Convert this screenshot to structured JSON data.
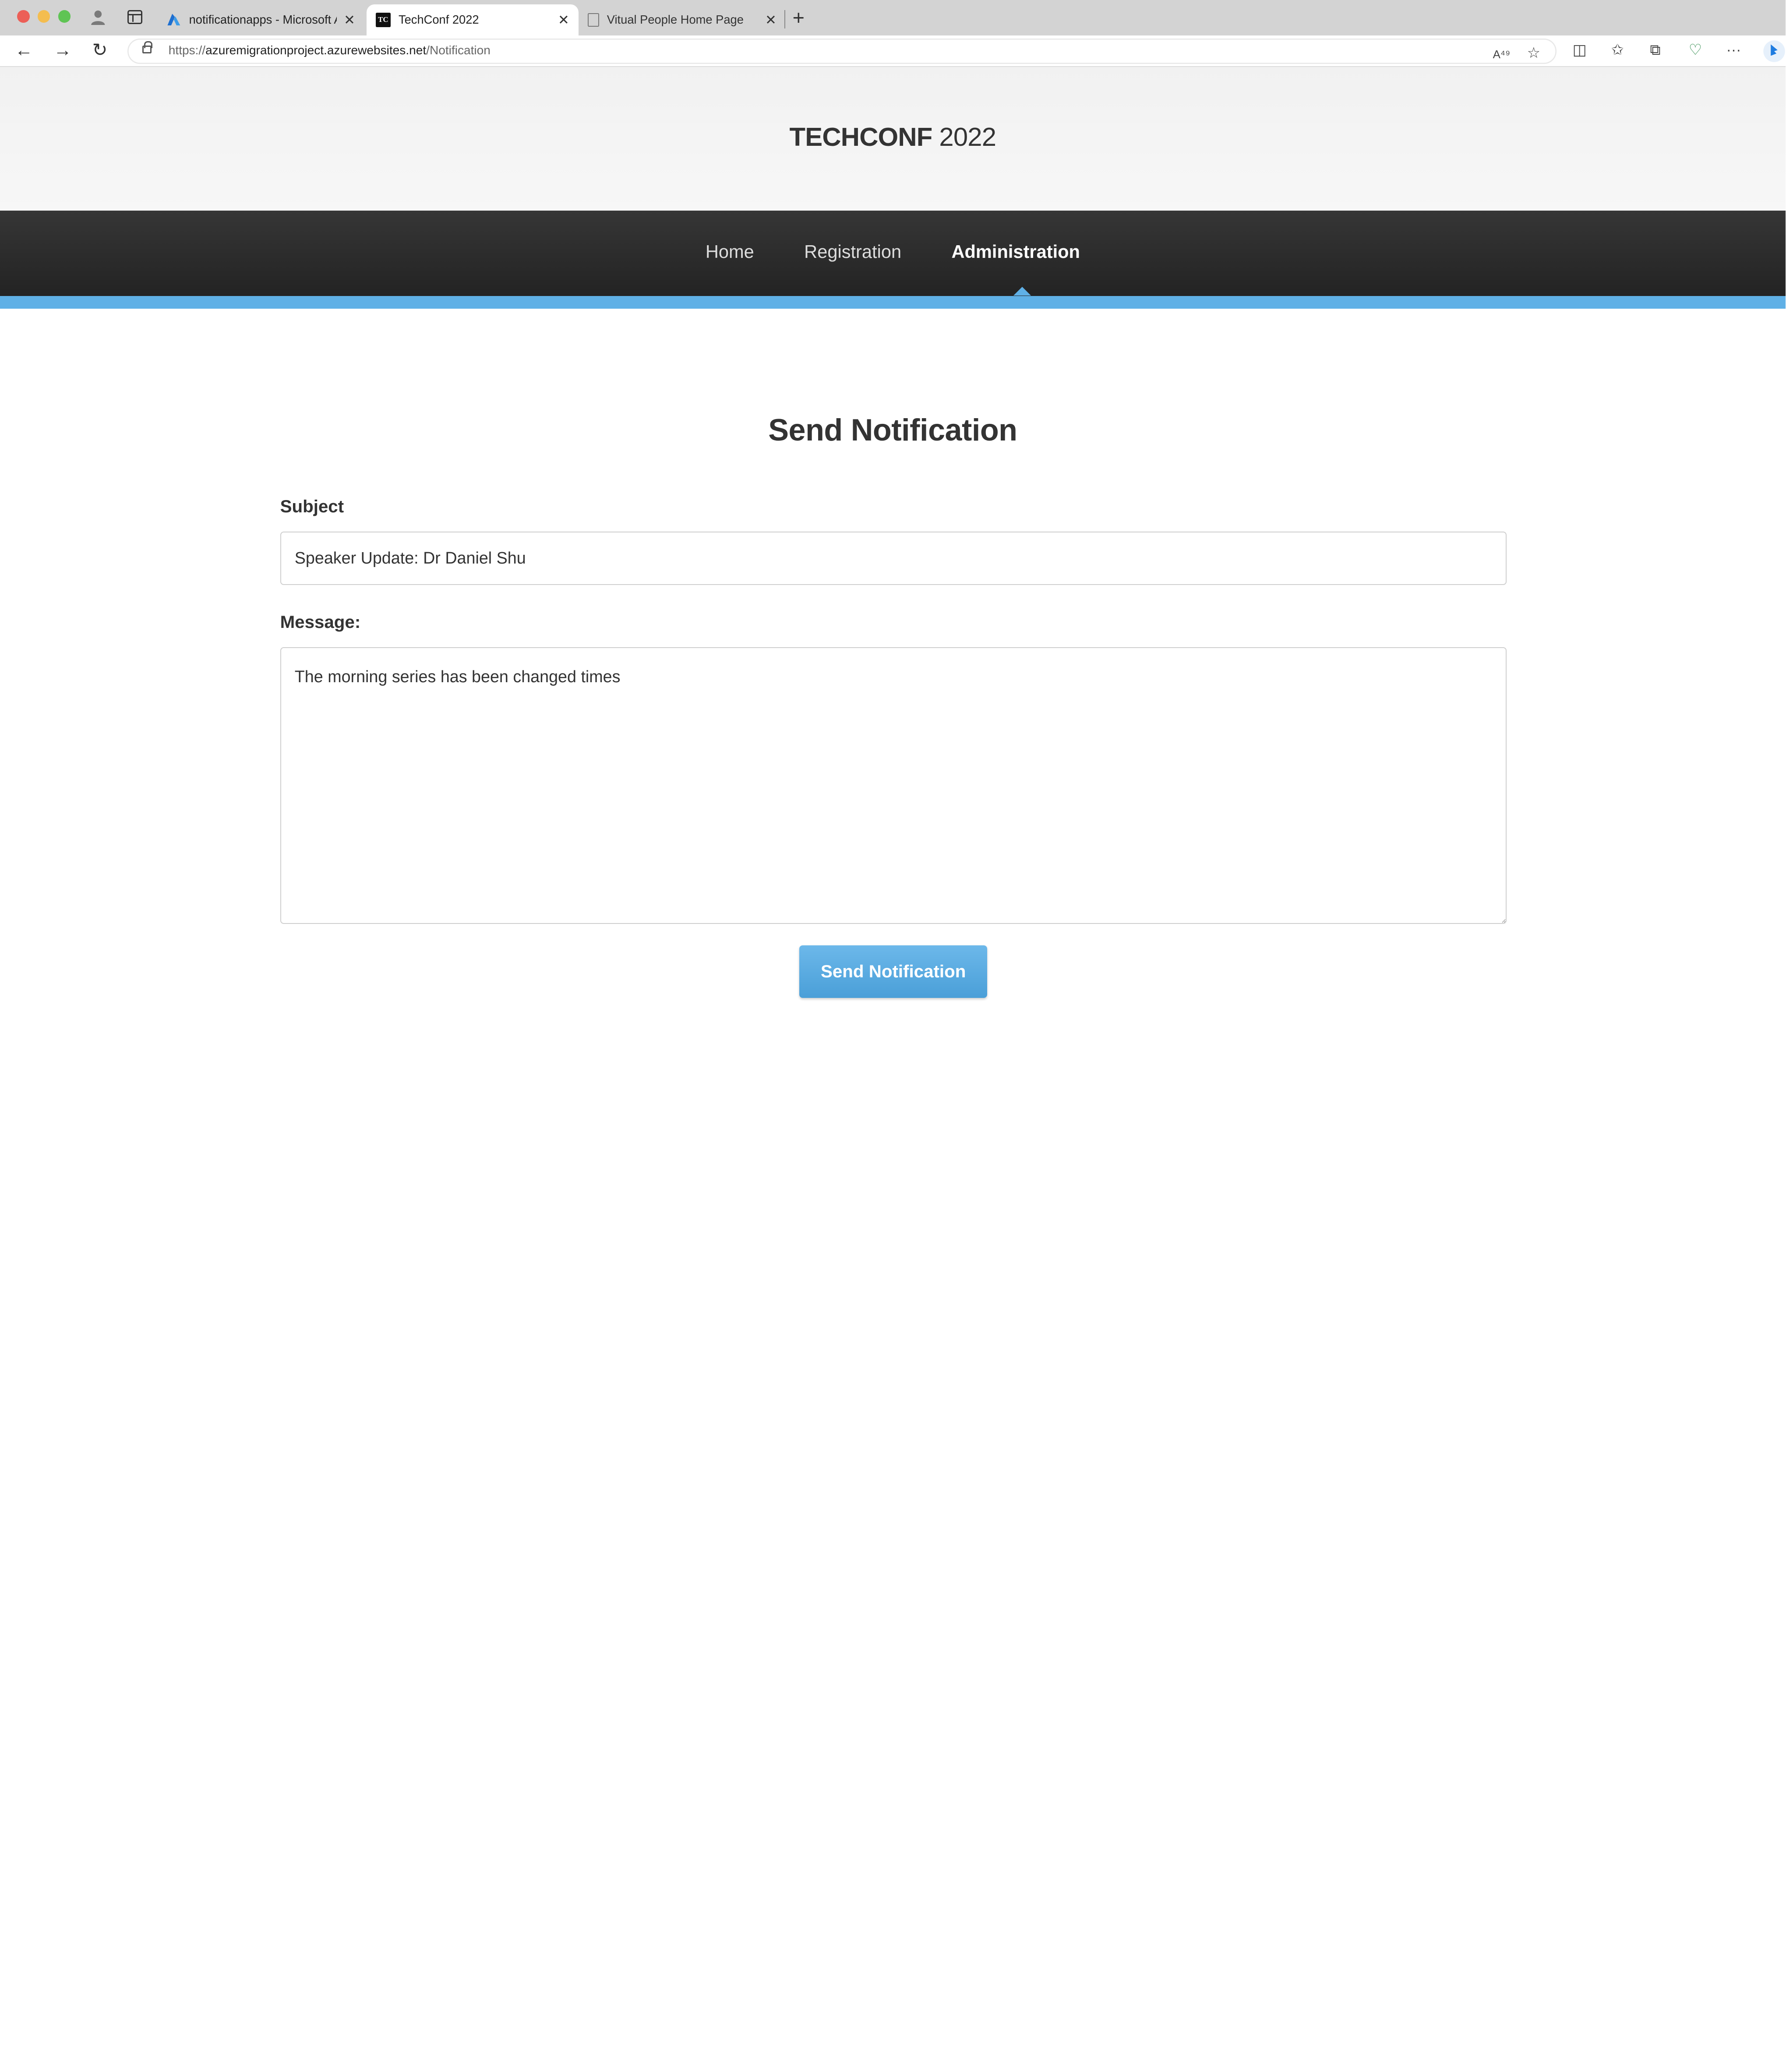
{
  "browser": {
    "tabs": [
      {
        "title": "notificationapps - Microsoft Az",
        "active": false,
        "favicon": "azure-logo-icon"
      },
      {
        "title": "TechConf 2022",
        "active": true,
        "favicon": "techconf-favicon-icon"
      },
      {
        "title": "Vitual People Home Page",
        "active": false,
        "favicon": "document-icon"
      }
    ],
    "url_prefix": "https://",
    "url_host": "azuremigrationproject.azurewebsites.net",
    "url_path": "/Notification",
    "read_aloud_glyph": "A⁴⁹",
    "favicon_text": "TC"
  },
  "site": {
    "brand_bold": "TECHCONF",
    "brand_year": "2022",
    "nav": [
      {
        "label": "Home",
        "active": false
      },
      {
        "label": "Registration",
        "active": false
      },
      {
        "label": "Administration",
        "active": true
      }
    ],
    "accent_color": "#5fb0e6",
    "navbar_color": "#2d2d2d"
  },
  "form": {
    "title": "Send Notification",
    "subject_label": "Subject",
    "subject_value": "Speaker Update: Dr Daniel Shu",
    "message_label": "Message:",
    "message_value": "The morning series has been changed times",
    "submit_label": "Send Notification"
  }
}
